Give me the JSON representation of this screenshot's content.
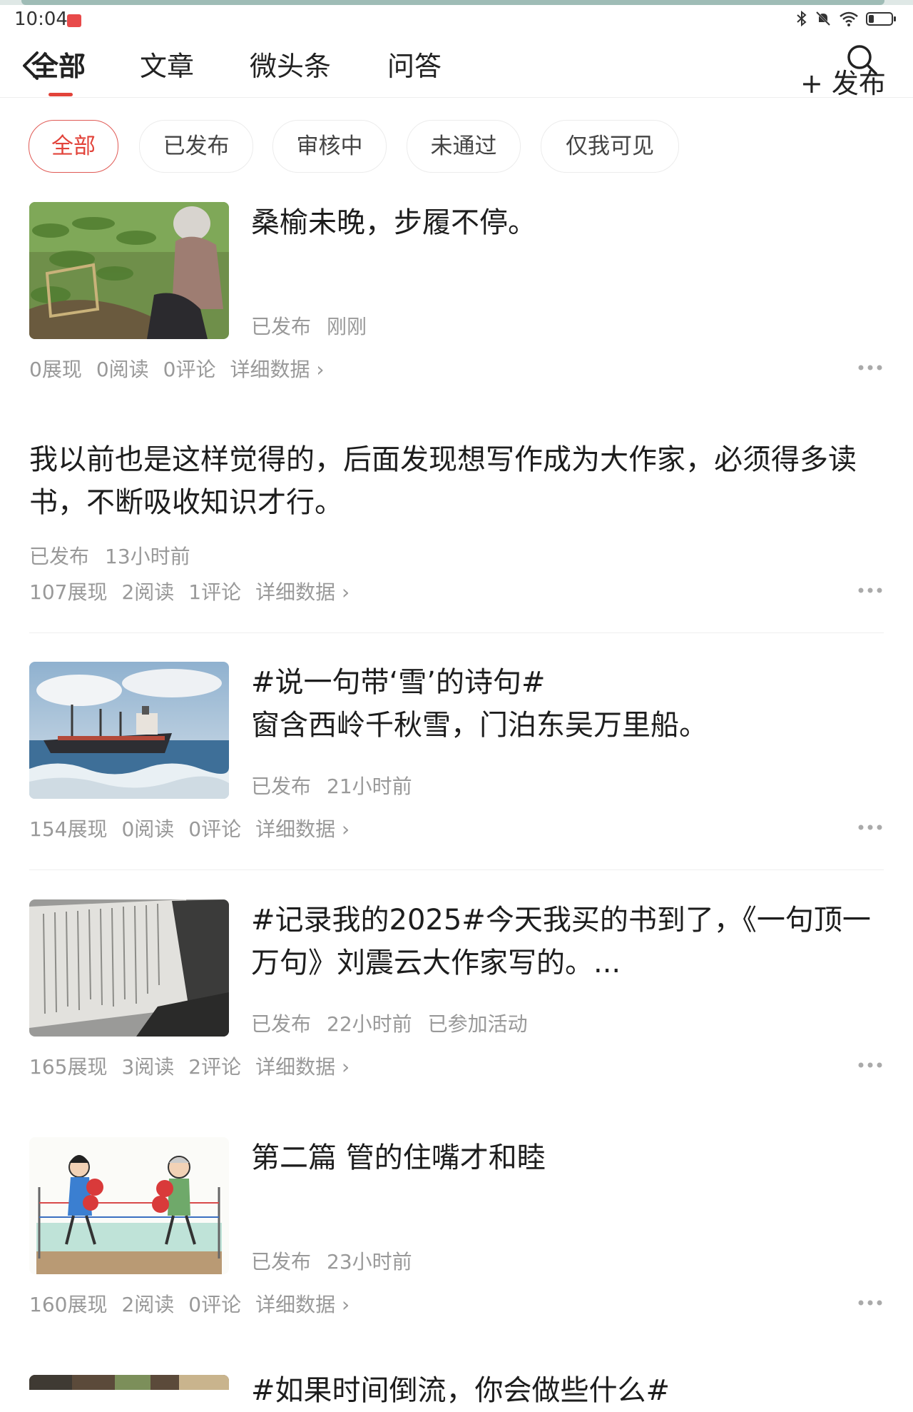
{
  "status_bar": {
    "time": "10:04"
  },
  "nav": {
    "tabs": [
      {
        "label": "全部"
      },
      {
        "label": "文章"
      },
      {
        "label": "微头条"
      },
      {
        "label": "问答"
      }
    ],
    "active_tab": "全部",
    "publish_label": "+ 发布"
  },
  "filters": [
    {
      "label": "全部"
    },
    {
      "label": "已发布"
    },
    {
      "label": "审核中"
    },
    {
      "label": "未通过"
    },
    {
      "label": "仅我可见"
    }
  ],
  "detail_label": "详细数据 ›",
  "posts": [
    {
      "title": "桑榆未晚，步履不停。",
      "status": "已发布",
      "time": "刚刚",
      "extra": "",
      "impressions": "0展现",
      "reads": "0阅读",
      "comments": "0评论"
    },
    {
      "title": "我以前也是这样觉得的，后面发现想写作成为大作家，必须得多读书，不断吸收知识才行。",
      "status": "已发布",
      "time": "13小时前",
      "extra": "",
      "impressions": "107展现",
      "reads": "2阅读",
      "comments": "1评论"
    },
    {
      "title_line1": "#说一句带‘雪’的诗句#",
      "title_line2": "窗含西岭千秋雪，门泊东吴万里船。",
      "status": "已发布",
      "time": "21小时前",
      "extra": "",
      "impressions": "154展现",
      "reads": "0阅读",
      "comments": "0评论"
    },
    {
      "title": "#记录我的2025#今天我买的书到了，《一句顶一万句》刘震云大作家写的。...",
      "status": "已发布",
      "time": "22小时前",
      "extra": "已参加活动",
      "impressions": "165展现",
      "reads": "3阅读",
      "comments": "2评论"
    },
    {
      "title": "第二篇 管的住嘴才和睦",
      "status": "已发布",
      "time": "23小时前",
      "extra": "",
      "impressions": "160展现",
      "reads": "2阅读",
      "comments": "0评论"
    },
    {
      "title": "#如果时间倒流，你会做些什么#"
    }
  ],
  "colors": {
    "accent": "#e2433a",
    "muted": "#999999",
    "text": "#1d1d1d"
  }
}
